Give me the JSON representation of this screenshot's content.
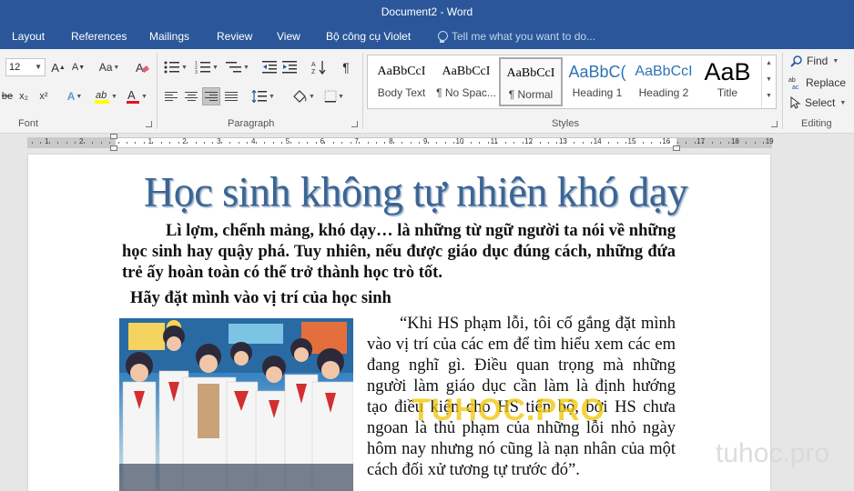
{
  "window": {
    "title": "Document2 - Word"
  },
  "tabs": [
    "Layout",
    "References",
    "Mailings",
    "Review",
    "View",
    "Bộ công cụ Violet"
  ],
  "tell_me": {
    "placeholder": "Tell me what you want to do..."
  },
  "font_group": {
    "label": "Font",
    "font_size": "12",
    "grow_font": "A",
    "shrink_font": "A",
    "change_case": "Aa",
    "subscript": "x₂",
    "superscript": "x²",
    "strike": "be",
    "text_effects": "A",
    "font_color": "A",
    "highlight_color": "#ffff00",
    "font_color_value": "#e81123"
  },
  "paragraph_group": {
    "label": "Paragraph"
  },
  "styles_group": {
    "label": "Styles",
    "items": [
      {
        "sample": "AaBbCcI",
        "name": "Body Text"
      },
      {
        "sample": "AaBbCcI",
        "name": "¶ No Spac..."
      },
      {
        "sample": "AaBbCcI",
        "name": "¶ Normal"
      },
      {
        "sample": "AaBbC(",
        "name": "Heading 1"
      },
      {
        "sample": "AaBbCcI",
        "name": "Heading 2"
      },
      {
        "sample": "AaB",
        "name": "Title"
      }
    ],
    "selected": "¶ Normal",
    "heading_color": "#2e74b5"
  },
  "editing_group": {
    "label": "Editing",
    "find": "Find",
    "replace": "Replace",
    "select": "Select"
  },
  "ruler": {
    "numbers_left": [
      "2",
      "1"
    ],
    "numbers_right": [
      "1",
      "2",
      "3",
      "4",
      "5",
      "6",
      "7",
      "8",
      "9",
      "10",
      "11",
      "12",
      "13",
      "14",
      "15",
      "16",
      "17",
      "18",
      "19"
    ]
  },
  "document": {
    "title": "Học sinh không tự nhiên khó dạy",
    "lead": "Lì lợm, chểnh mảng, khó dạy… là những từ ngữ người ta nói về những học sinh hay quậy phá. Tuy nhiên, nếu được giáo dục đúng cách, những đứa trẻ ấy hoàn toàn có thể trở thành học trò tốt.",
    "heading": "Hãy đặt mình vào vị trí của học sinh",
    "body": "“Khi HS phạm lỗi, tôi cố gắng đặt mình vào vị trí của các em để tìm hiểu xem các em đang nghĩ gì. Điều quan trọng mà những người làm giáo dục cần làm là định hướng tạo điều kiện cho HS tiến bộ, bởi HS chưa ngoan là thủ phạm của những lỗi nhỏ ngày hôm nay nhưng nó cũng là nạn nhân của một cách đối xử tương tự trước đó”.",
    "title_color": "#3b6593"
  },
  "watermarks": {
    "center": "TUHOC.PRO",
    "corner": "tuhoc.pro"
  }
}
